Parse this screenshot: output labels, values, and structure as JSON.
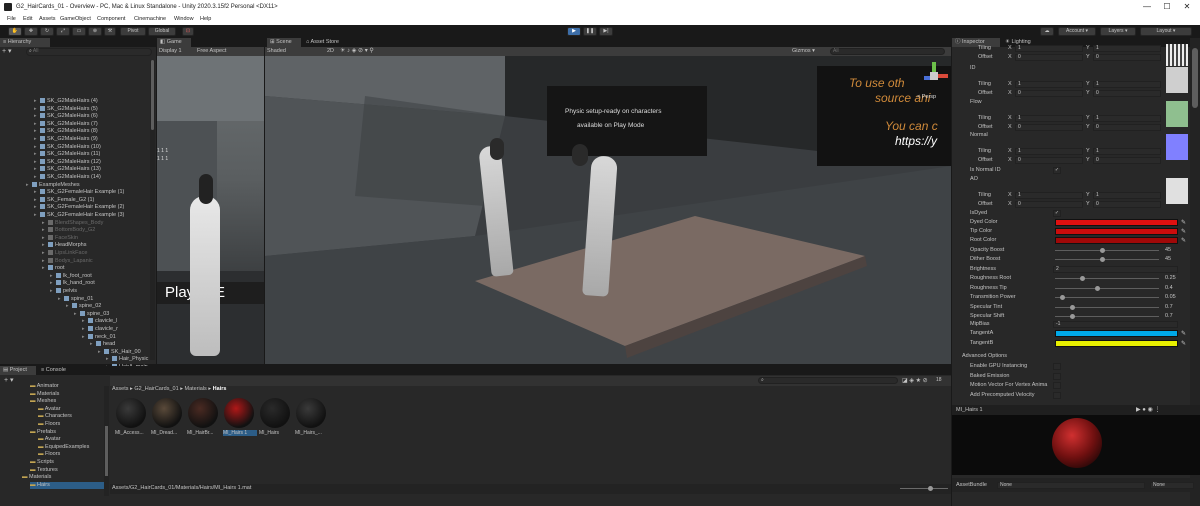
{
  "window": {
    "title": "G2_HairCards_01 - Overview - PC, Mac & Linux Standalone - Unity 2020.3.15f2 Personal <DX11>",
    "minimize": "—",
    "maximize": "☐",
    "close": "✕"
  },
  "menu": [
    "File",
    "Edit",
    "Assets",
    "GameObject",
    "Component",
    "Cinemachine",
    "Window",
    "Help"
  ],
  "toolbar": {
    "pivot": "Pivot",
    "global": "Global",
    "account": "Account ▾",
    "layers": "Layers ▾",
    "layout": "Layout ▾"
  },
  "hierarchy": {
    "tab": "Hierarchy",
    "search_placeholder": "All",
    "rows": [
      {
        "label": "SK_G2MaleHairs (4)",
        "indent": 34,
        "grey": false
      },
      {
        "label": "SK_G2MaleHairs (5)",
        "indent": 34,
        "grey": false
      },
      {
        "label": "SK_G2MaleHairs (6)",
        "indent": 34,
        "grey": false
      },
      {
        "label": "SK_G2MaleHairs (7)",
        "indent": 34,
        "grey": false
      },
      {
        "label": "SK_G2MaleHairs (8)",
        "indent": 34,
        "grey": false
      },
      {
        "label": "SK_G2MaleHairs (9)",
        "indent": 34,
        "grey": false
      },
      {
        "label": "SK_G2MaleHairs (10)",
        "indent": 34,
        "grey": false
      },
      {
        "label": "SK_G2MaleHairs (11)",
        "indent": 34,
        "grey": false
      },
      {
        "label": "SK_G2MaleHairs (12)",
        "indent": 34,
        "grey": false
      },
      {
        "label": "SK_G2MaleHairs (13)",
        "indent": 34,
        "grey": false
      },
      {
        "label": "SK_G2MaleHairs (14)",
        "indent": 34,
        "grey": false
      },
      {
        "label": "ExampleMeshes",
        "indent": 26,
        "grey": false
      },
      {
        "label": "SK_G2FemaleHair Example (1)",
        "indent": 34,
        "grey": false
      },
      {
        "label": "SK_Female_G2 (1)",
        "indent": 34,
        "grey": false
      },
      {
        "label": "SK_G2FemaleHair Example (2)",
        "indent": 34,
        "grey": false
      },
      {
        "label": "SK_G2FemaleHair Example (3)",
        "indent": 34,
        "grey": false
      },
      {
        "label": "BlendShapes_Body",
        "indent": 42,
        "grey": true
      },
      {
        "label": "BottomBody_G2",
        "indent": 42,
        "grey": true
      },
      {
        "label": "FaceSkin",
        "indent": 42,
        "grey": true
      },
      {
        "label": "HeadMorphs",
        "indent": 42,
        "grey": false
      },
      {
        "label": "LipsLinkFace",
        "indent": 42,
        "grey": true
      },
      {
        "label": "Bodys_Lapanic",
        "indent": 42,
        "grey": true
      },
      {
        "label": "root",
        "indent": 42,
        "grey": false
      },
      {
        "label": "lk_foot_root",
        "indent": 50,
        "grey": false
      },
      {
        "label": "lk_hand_root",
        "indent": 50,
        "grey": false
      },
      {
        "label": "pelvis",
        "indent": 50,
        "grey": false
      },
      {
        "label": "spine_01",
        "indent": 58,
        "grey": false
      },
      {
        "label": "spine_02",
        "indent": 66,
        "grey": false
      },
      {
        "label": "spine_03",
        "indent": 74,
        "grey": false
      },
      {
        "label": "clavicle_l",
        "indent": 82,
        "grey": false
      },
      {
        "label": "clavicle_r",
        "indent": 82,
        "grey": false
      },
      {
        "label": "neck_01",
        "indent": 82,
        "grey": false
      },
      {
        "label": "head",
        "indent": 90,
        "grey": false
      },
      {
        "label": "SK_Hair_00",
        "indent": 98,
        "grey": false
      },
      {
        "label": "Hair_Physic",
        "indent": 106,
        "grey": false
      },
      {
        "label": "HairA_main",
        "indent": 106,
        "grey": false
      },
      {
        "label": "HairAback_in",
        "indent": 106,
        "grey": false
      },
      {
        "label": "HairAback_ou",
        "indent": 106,
        "grey": false
      },
      {
        "label": "HairAF_in",
        "indent": 106,
        "grey": false
      },
      {
        "label": "HairAF_out",
        "indent": 106,
        "grey": false
      }
    ]
  },
  "game": {
    "tab": "Game",
    "display": "Display 1",
    "aspect": "Free Aspect",
    "overlay_text": "Play to E",
    "small_text": "1 1 1"
  },
  "scene": {
    "tabs": [
      "Scene",
      "Asset Store"
    ],
    "shading": "Shaded",
    "mode": "2D",
    "gizmos": "Gizmos ▾",
    "search": "All",
    "sign_lines": [
      "Physic setup-ready on characters",
      "available on Play Mode"
    ],
    "orange_lines": [
      "To use oth",
      "source ani",
      "You can c"
    ],
    "white_line": "https://y",
    "persp": "< Persp"
  },
  "inspector": {
    "tabs": [
      "Inspector",
      "Lighting"
    ],
    "top_rows": [
      {
        "label": "",
        "sub": "Tiling",
        "x": "1",
        "y": "1"
      },
      {
        "label": "",
        "sub": "Offset",
        "x": "0",
        "y": "0"
      }
    ],
    "sections": [
      {
        "name": "ID",
        "tiling": [
          "1",
          "1"
        ],
        "offset": [
          "0",
          "0"
        ],
        "thumb": "#cfcfcf"
      },
      {
        "name": "Flow",
        "tiling": [
          "1",
          "1"
        ],
        "offset": [
          "0",
          "0"
        ],
        "thumb": "#8fbf8f"
      },
      {
        "name": "Normal",
        "tiling": [
          "1",
          "1"
        ],
        "offset": [
          "0",
          "0"
        ],
        "thumb": "#8080ff"
      },
      {
        "name": "AO",
        "tiling": [
          "1",
          "1"
        ],
        "offset": [
          "0",
          "0"
        ],
        "thumb": "#e0e0e0"
      }
    ],
    "normal_id_label": "Is Normal ID",
    "normal_id": true,
    "isdyed_label": "IsDyed",
    "isdyed": true,
    "colors": [
      {
        "label": "Dyed Color",
        "value": "#e01010"
      },
      {
        "label": "Tip Color",
        "value": "#cc0c0c"
      },
      {
        "label": "Root Color",
        "value": "#a00808"
      }
    ],
    "sliders": [
      {
        "label": "Opacity Boost",
        "value": "45",
        "frac": 0.45
      },
      {
        "label": "Dither Boost",
        "value": "45",
        "frac": 0.45
      }
    ],
    "brightness_label": "Brightness",
    "brightness": "2",
    "sliders2": [
      {
        "label": "Roughness Root",
        "value": "0.25",
        "frac": 0.25
      },
      {
        "label": "Roughness Tip",
        "value": "0.4",
        "frac": 0.4
      },
      {
        "label": "Transmition Power",
        "value": "0.05",
        "frac": 0.05
      },
      {
        "label": "Specular Tint",
        "value": "0.7",
        "frac": 0.15
      },
      {
        "label": "Specular Shift",
        "value": "0.7",
        "frac": 0.15
      }
    ],
    "mipbias_label": "MipBias",
    "mipbias": "-1",
    "tangents": [
      {
        "label": "TangentA",
        "value": "#00a8e8"
      },
      {
        "label": "TangentB",
        "value": "#e8f000"
      }
    ],
    "advanced_label": "Advanced Options",
    "advanced": [
      "Enable GPU Instancing",
      "Baked Emission",
      "Motion Vector For Vertex Anima",
      "Add Precomputed Velocity"
    ],
    "preview_name": "MI_Hairs 1",
    "assetbundle_label": "AssetBundle",
    "assetbundle_value": "None",
    "assetbundle_variant": "None"
  },
  "project": {
    "tabs": [
      "Project",
      "Console"
    ],
    "tree": [
      {
        "label": "Animator",
        "indent": 30
      },
      {
        "label": "Materials",
        "indent": 30
      },
      {
        "label": "Meshes",
        "indent": 30
      },
      {
        "label": "Avatar",
        "indent": 38
      },
      {
        "label": "Characters",
        "indent": 38
      },
      {
        "label": "Floors",
        "indent": 38
      },
      {
        "label": "Prefabs",
        "indent": 30
      },
      {
        "label": "Avatar",
        "indent": 38
      },
      {
        "label": "EquipedExamples",
        "indent": 38
      },
      {
        "label": "Floors",
        "indent": 38
      },
      {
        "label": "Scripts",
        "indent": 30
      },
      {
        "label": "Textures",
        "indent": 30
      },
      {
        "label": "Materials",
        "indent": 22
      },
      {
        "label": "Hairs",
        "indent": 30
      }
    ],
    "breadcrumb": [
      "Assets",
      "G2_HairCards_01",
      "Materials",
      "Hairs"
    ],
    "assets": [
      {
        "label": "MI_Access...",
        "color": "#3a3a3a",
        "sel": false
      },
      {
        "label": "MI_Dread...",
        "color": "#5a4a3a",
        "sel": false
      },
      {
        "label": "MI_HairBr...",
        "color": "#4a2a22",
        "sel": false
      },
      {
        "label": "MI_Hairs 1",
        "color": "#b01818",
        "sel": true
      },
      {
        "label": "MI_Hairs",
        "color": "#2a2a2a",
        "sel": false
      },
      {
        "label": "MI_Hairs_...",
        "color": "#3a3a3a",
        "sel": false
      }
    ],
    "path": "Assets/G2_HairCards_01/Materials/Hairs/MI_Hairs 1.mat",
    "count": "18"
  }
}
